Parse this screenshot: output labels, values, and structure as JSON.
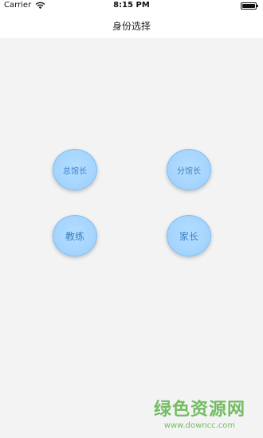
{
  "status_bar": {
    "carrier": "Carrier",
    "time": "8:15 PM",
    "battery_level": 1.0
  },
  "nav": {
    "title": "身份选择"
  },
  "roles": [
    {
      "label": "总馆长"
    },
    {
      "label": "分馆长"
    },
    {
      "label": "教练"
    },
    {
      "label": "家长"
    }
  ],
  "watermark": {
    "title": "绿色资源网",
    "url": "www.downcc.com"
  },
  "colors": {
    "button_fill": "#a3d3fd",
    "button_text": "#3c7fc4",
    "watermark": "#5fb34a"
  }
}
